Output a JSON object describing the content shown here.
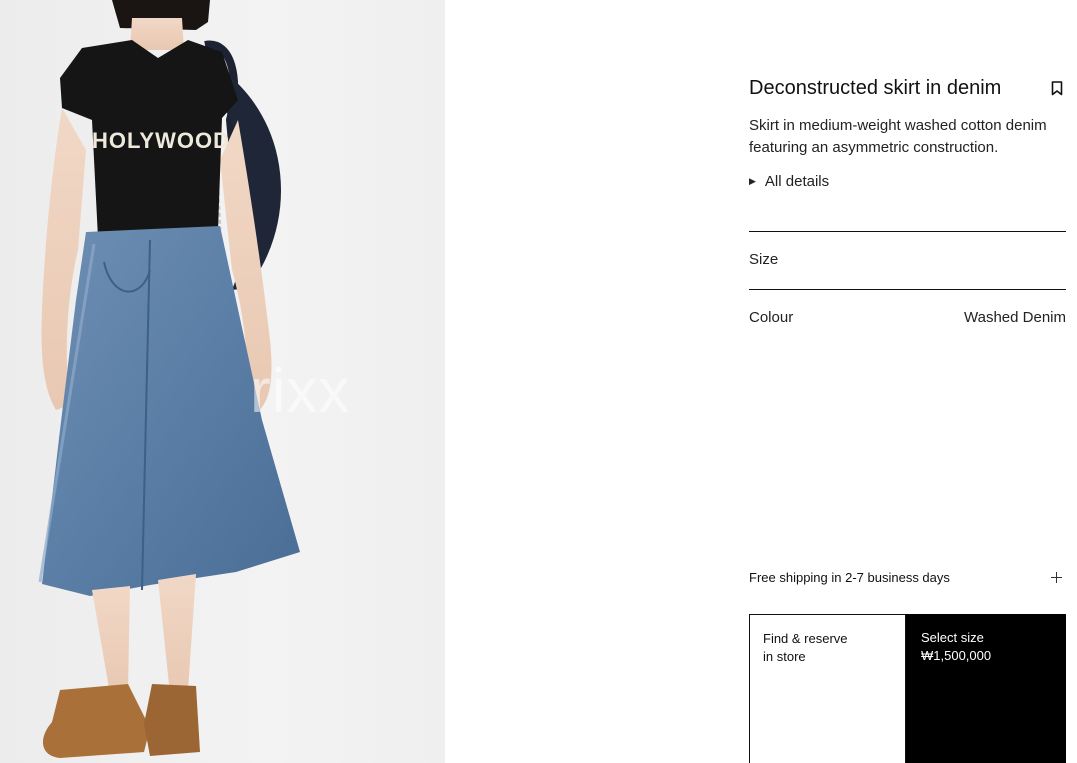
{
  "image": {
    "alt_icon": "product-photo",
    "watermark": "rixx",
    "shirt_print": "HOLYWOOD"
  },
  "product": {
    "title": "Deconstructed skirt in denim",
    "description_line1": "Skirt in medium-weight washed cotton denim",
    "description_line2": "featuring an asymmetric construction.",
    "details_label": "All details",
    "details_icon": "triangle-right-icon",
    "bookmark_icon": "bookmark-icon"
  },
  "options": {
    "size_label": "Size",
    "colour_label": "Colour",
    "colour_value": "Washed Denim"
  },
  "shipping": {
    "label": "Free shipping in 2-7 business days",
    "icon": "plus-icon"
  },
  "actions": {
    "reserve_line1": "Find & reserve",
    "reserve_line2": "in store",
    "select_line1": "Select size",
    "select_line2": "₩1,500,000"
  },
  "colors": {
    "primary_button_bg": "#000000",
    "text": "#111111",
    "background": "#ffffff"
  }
}
